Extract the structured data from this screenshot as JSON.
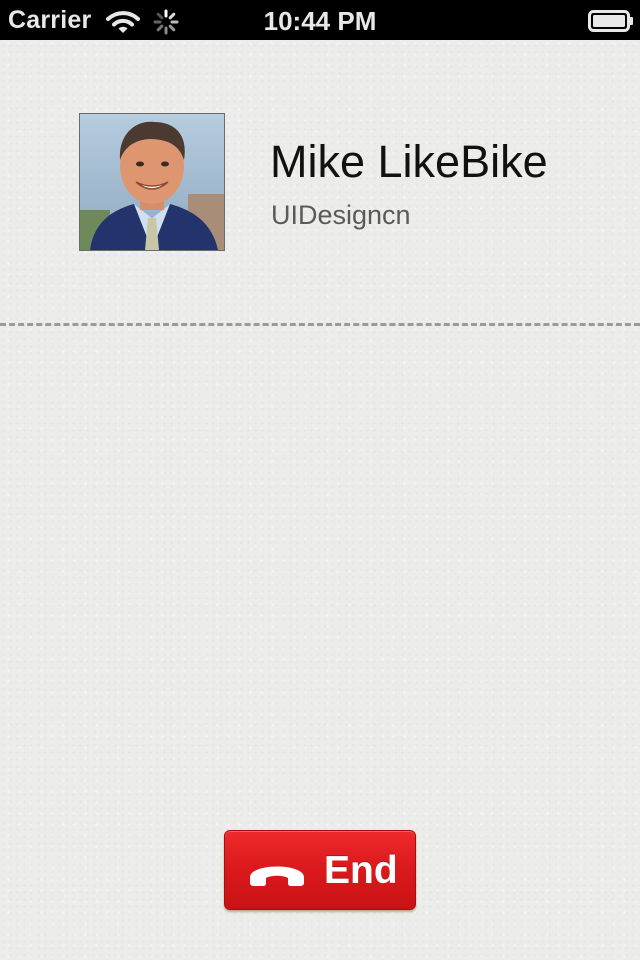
{
  "status_bar": {
    "carrier": "Carrier",
    "time": "10:44 PM",
    "icons": [
      "wifi-icon",
      "spinner-icon",
      "battery-icon"
    ]
  },
  "contact": {
    "name": "Mike LikeBike",
    "company": "UIDesigncn",
    "avatar_icon": "contact-photo"
  },
  "call_controls": {
    "end_label": "End",
    "end_icon": "phone-hangup-icon",
    "end_color": "#dc1a1d"
  },
  "colors": {
    "background": "#ececea",
    "status_bar": "#000000",
    "divider": "#9a9a9a",
    "name_text": "#111111",
    "company_text": "#5a5a5a"
  }
}
